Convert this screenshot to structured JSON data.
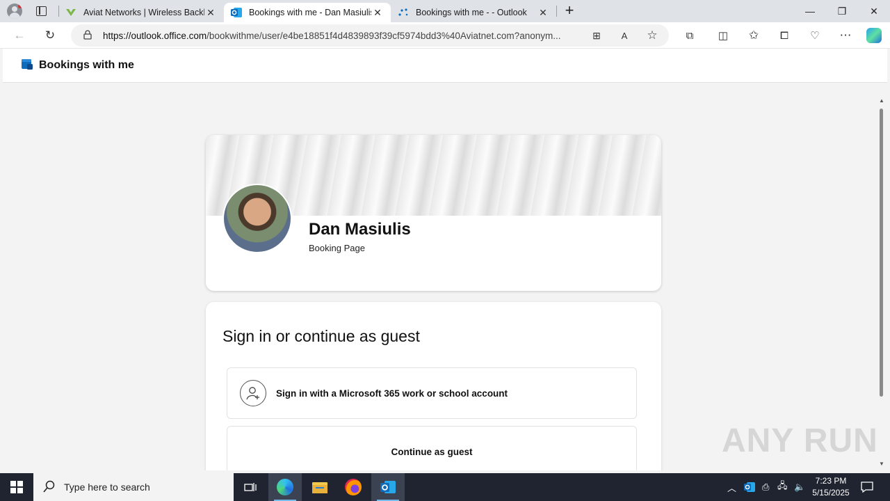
{
  "browser": {
    "tabs": [
      {
        "title": "Aviat Networks | Wireless Backha"
      },
      {
        "title": "Bookings with me - Dan Masiulis"
      },
      {
        "title": "Bookings with me - - Outlook"
      }
    ],
    "url_host": "https://outlook.office.com",
    "url_path": "/bookwithme/user/e4be18851f4d4839893f39cf5974bdd3%40Aviatnet.com?anonym..."
  },
  "app": {
    "title": "Bookings with me"
  },
  "profile": {
    "name": "Dan Masiulis",
    "subtitle": "Booking Page"
  },
  "signin": {
    "heading": "Sign in or continue as guest",
    "option_account": "Sign in with a Microsoft 365 work or school account",
    "option_guest": "Continue as guest"
  },
  "watermark": "ANY RUN",
  "taskbar": {
    "search_placeholder": "Type here to search",
    "time": "7:23 PM",
    "date": "5/15/2025"
  },
  "colors": {
    "accent": "#0f6cbd",
    "taskbar": "#1f2430"
  }
}
